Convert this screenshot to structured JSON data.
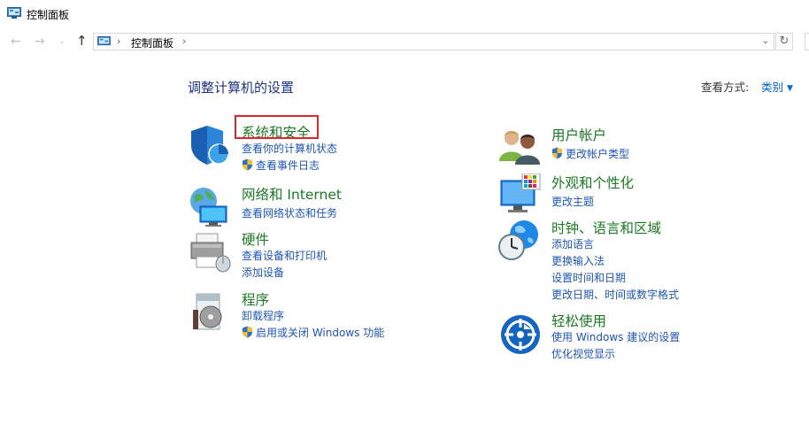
{
  "window": {
    "title": "控制面板"
  },
  "address": {
    "crumb": "控制面板"
  },
  "main": {
    "heading": "调整计算机的设置",
    "view_by_label": "查看方式:",
    "view_by_value": "类别"
  },
  "left_categories": [
    {
      "title": "系统和安全",
      "links": [
        "查看你的计算机状态",
        "查看事件日志"
      ]
    },
    {
      "title": "网络和 Internet",
      "links": [
        "查看网络状态和任务"
      ]
    },
    {
      "title": "硬件",
      "links": [
        "查看设备和打印机",
        "添加设备"
      ]
    },
    {
      "title": "程序",
      "links": [
        "卸载程序",
        "启用或关闭 Windows 功能"
      ]
    }
  ],
  "right_categories": [
    {
      "title": "用户帐户",
      "links": [
        "更改帐户类型"
      ]
    },
    {
      "title": "外观和个性化",
      "links": [
        "更改主题"
      ]
    },
    {
      "title": "时钟、语言和区域",
      "links": [
        "添加语言",
        "更换输入法",
        "设置时间和日期",
        "更改日期、时间或数字格式"
      ]
    },
    {
      "title": "轻松使用",
      "links": [
        "使用 Windows 建议的设置",
        "优化视觉显示"
      ]
    }
  ],
  "colors": {
    "category_title": "#1a7a22",
    "link": "#1d55b8",
    "heading": "#1e3287",
    "highlight": "#e0252a"
  }
}
